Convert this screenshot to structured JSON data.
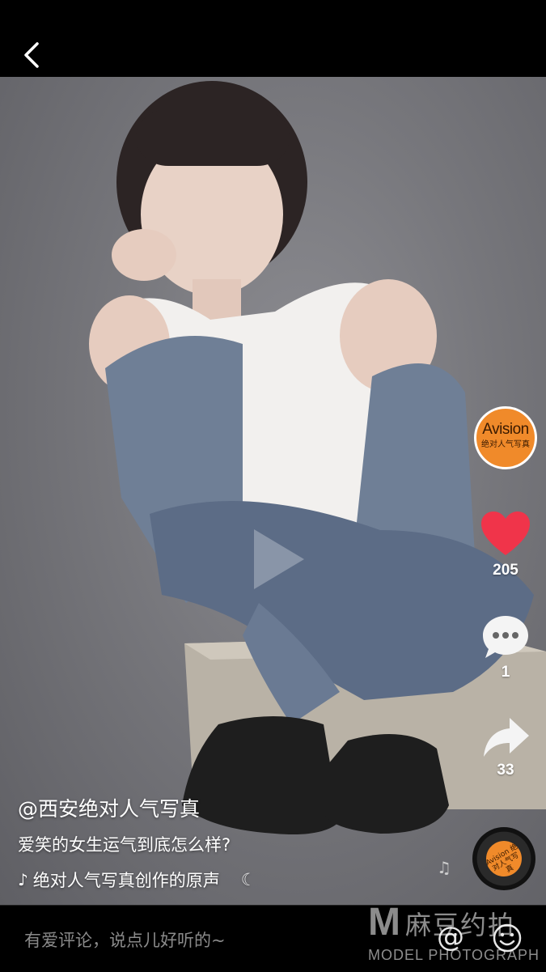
{
  "header": {
    "back_icon": "chevron-left-icon"
  },
  "video": {
    "play_icon": "play-icon"
  },
  "creator_avatar": {
    "brand": "Avision",
    "subtitle": "绝对人气写真"
  },
  "actions": {
    "like": {
      "icon": "heart-icon",
      "count": "205",
      "color": "#f0344a"
    },
    "comment": {
      "icon": "speech-bubble-icon",
      "count": "1"
    },
    "share": {
      "icon": "share-arrow-icon",
      "count": "33"
    }
  },
  "post": {
    "author": "@西安绝对人气写真",
    "caption": "爱笑的女生运气到底怎么样?",
    "music_icon": "tiktok-note-icon",
    "music": "绝对人气写真创作的原声"
  },
  "disc": {
    "label": "Avision 绝对人气写真"
  },
  "comment_bar": {
    "placeholder": "有爱评论，说点儿好听的~",
    "mention_label": "@",
    "emoji_icon": "smile-icon"
  },
  "watermark": {
    "logo": "M",
    "cn": "麻豆约拍",
    "en": "MODEL PHOTOGRAPH"
  },
  "colors": {
    "accent": "#f08a2a",
    "like": "#f0344a"
  }
}
